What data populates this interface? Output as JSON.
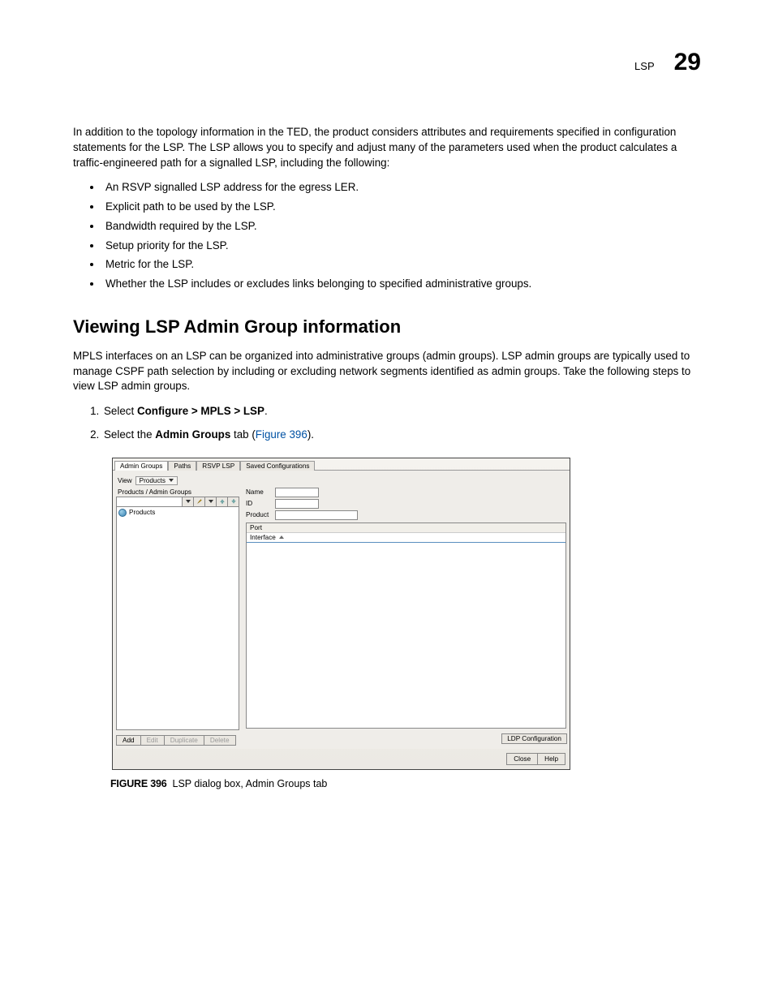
{
  "header": {
    "label": "LSP",
    "chapter": "29"
  },
  "intro": "In addition to the topology information in the TED, the product considers attributes and requirements specified in configuration statements for the LSP. The LSP allows you to specify and adjust many of the parameters used when the product calculates a traffic-engineered path for a signalled LSP, including the following:",
  "bullets": [
    "An RSVP signalled LSP address for the egress LER.",
    "Explicit path to be used by the LSP.",
    "Bandwidth required by the LSP.",
    "Setup priority for the LSP.",
    "Metric for the LSP.",
    "Whether the LSP includes or excludes links belonging to specified administrative groups."
  ],
  "section_title": "Viewing LSP Admin Group information",
  "section_para": "MPLS interfaces on an LSP can be organized into administrative groups (admin groups). LSP admin groups are typically used to manage CSPF path selection by including or excluding network segments identified as admin groups. Take the following steps to view LSP admin groups.",
  "steps": {
    "s1_pre": "Select ",
    "s1_bold": "Configure > MPLS > LSP",
    "s1_post": ".",
    "s2_pre": "Select the ",
    "s2_bold": "Admin Groups",
    "s2_mid": " tab (",
    "s2_link": "Figure 396",
    "s2_post": ")."
  },
  "ui": {
    "tabs": [
      "Admin Groups",
      "Paths",
      "RSVP LSP",
      "Saved Configurations"
    ],
    "view_label": "View",
    "view_value": "Products",
    "panel_title": "Products / Admin Groups",
    "tree_root": "Products",
    "buttons": {
      "add": "Add",
      "edit": "Edit",
      "duplicate": "Duplicate",
      "delete": "Delete"
    },
    "fields": {
      "name": "Name",
      "id": "ID",
      "product": "Product"
    },
    "port": {
      "header": "Port",
      "col": "Interface"
    },
    "ldp_btn": "LDP Configuration",
    "close": "Close",
    "help": "Help"
  },
  "figure": {
    "lead": "FIGURE 396",
    "caption": "LSP dialog box, Admin Groups tab"
  }
}
